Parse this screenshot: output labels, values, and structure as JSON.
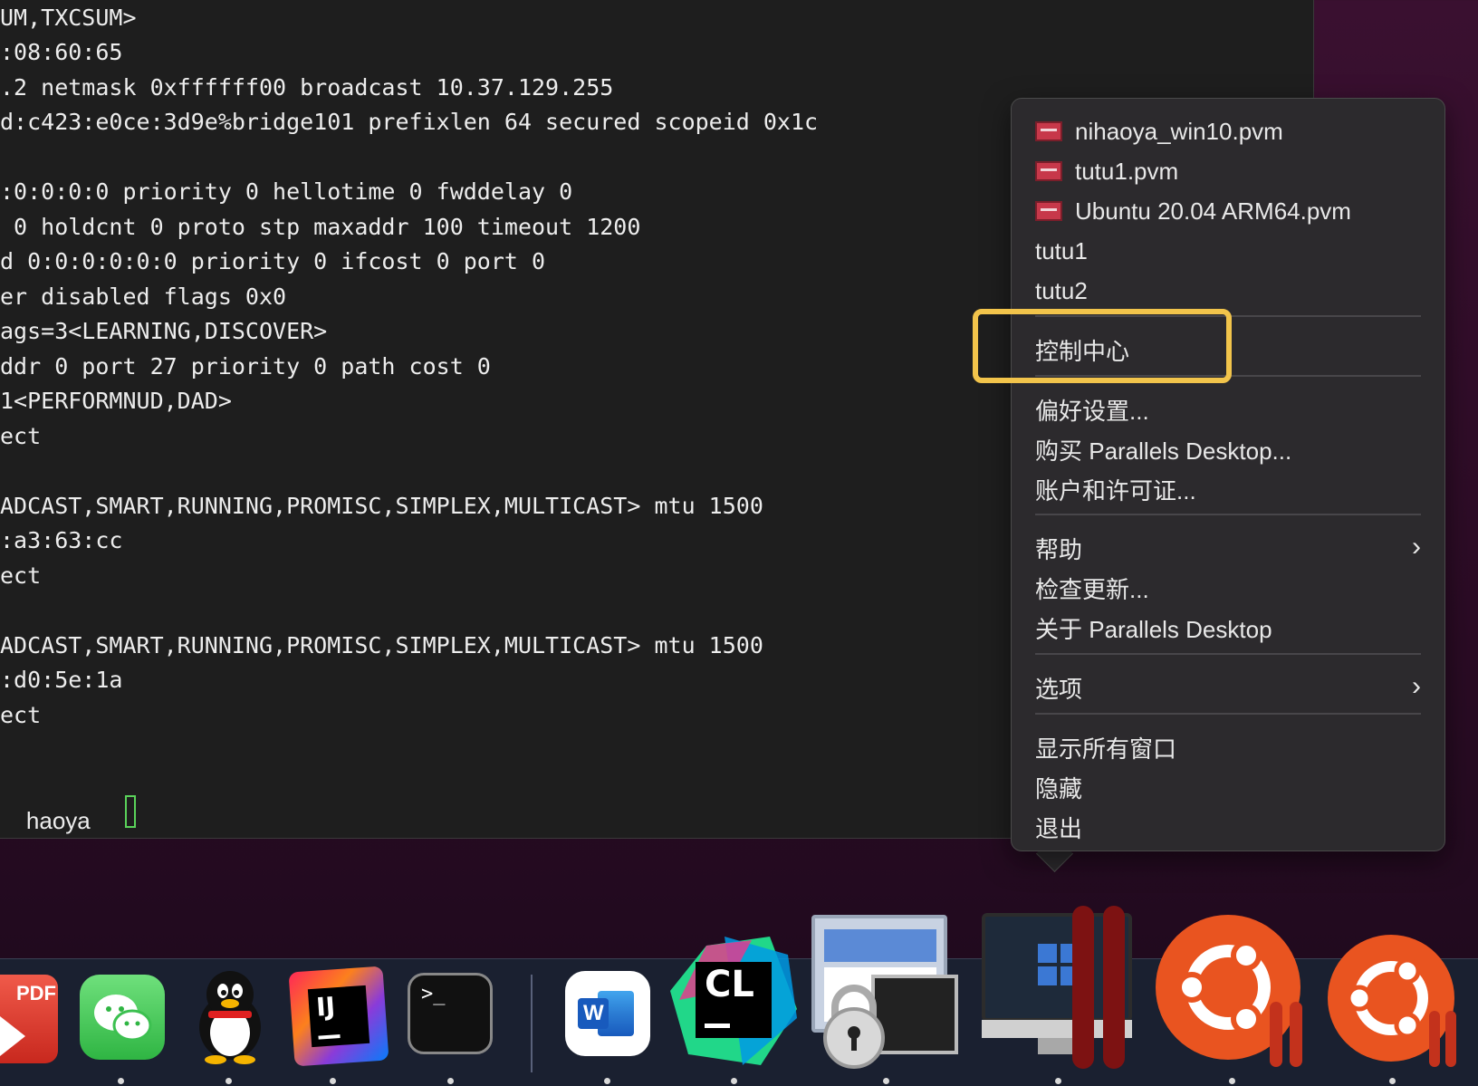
{
  "terminal": {
    "lines": [
      "UM,TXCSUM>",
      ":08:60:65",
      ".2 netmask 0xffffff00 broadcast 10.37.129.255",
      "d:c423:e0ce:3d9e%bridge101 prefixlen 64 secured scopeid 0x1c",
      "",
      ":0:0:0:0 priority 0 hellotime 0 fwddelay 0",
      " 0 holdcnt 0 proto stp maxaddr 100 timeout 1200",
      "d 0:0:0:0:0:0 priority 0 ifcost 0 port 0",
      "er disabled flags 0x0",
      "ags=3<LEARNING,DISCOVER>",
      "ddr 0 port 27 priority 0 path cost 0",
      "1<PERFORMNUD,DAD>",
      "ect",
      "",
      "ADCAST,SMART,RUNNING,PROMISC,SIMPLEX,MULTICAST> mtu 1500",
      ":a3:63:cc",
      "ect",
      "",
      "ADCAST,SMART,RUNNING,PROMISC,SIMPLEX,MULTICAST> mtu 1500",
      ":d0:5e:1a",
      "ect"
    ],
    "prompt_user": "haoya",
    "prompt_symbol": "~ >"
  },
  "menu": {
    "vm_files": [
      "nihaoya_win10.pvm",
      "tutu1.pvm",
      "Ubuntu 20.04 ARM64.pvm"
    ],
    "vms": [
      "tutu1",
      "tutu2"
    ],
    "control_center": "控制中心",
    "preferences": "偏好设置...",
    "buy": "购买 Parallels Desktop...",
    "account": "账户和许可证...",
    "help": "帮助",
    "check_updates": "检查更新...",
    "about": "关于 Parallels Desktop",
    "options": "选项",
    "show_all_windows": "显示所有窗口",
    "hide": "隐藏",
    "quit": "退出"
  },
  "dock": {
    "pdf_label": "PDF",
    "intellij_label": "IJ",
    "terminal_label": ">_",
    "word_label": "W",
    "clion_label": "CL"
  },
  "colors": {
    "highlight": "#f2c44b",
    "menu_bg": "#2c2a2d",
    "terminal_bg": "#1e1e1e",
    "ubuntu_orange": "#e95420"
  }
}
